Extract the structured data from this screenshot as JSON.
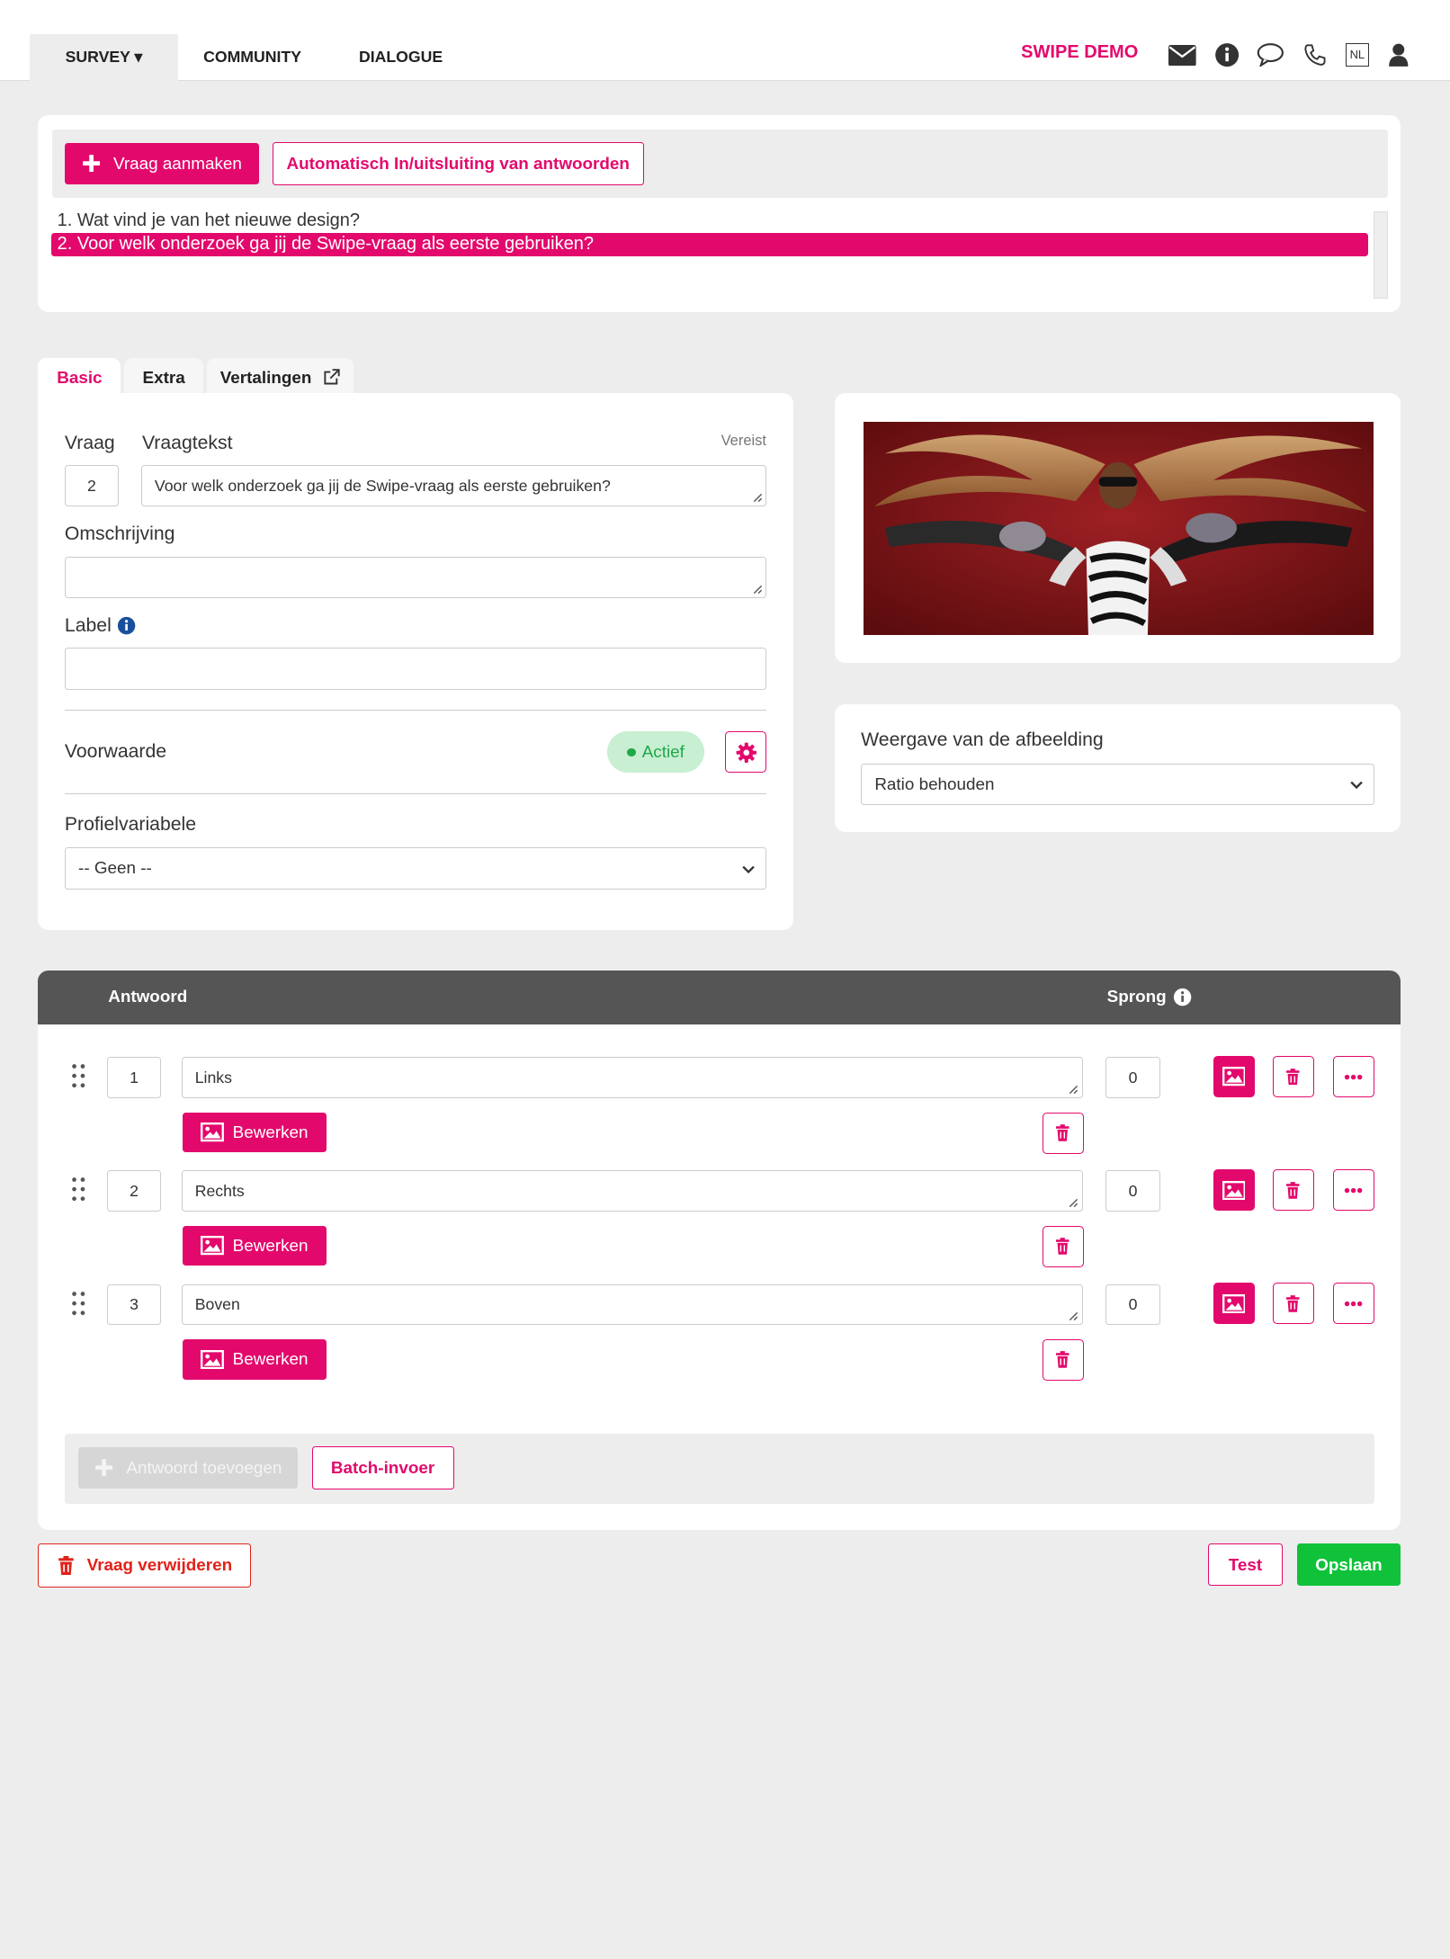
{
  "nav": {
    "tabs": [
      {
        "label": "SURVEY ▾"
      },
      {
        "label": "COMMUNITY"
      },
      {
        "label": "DIALOGUE"
      }
    ],
    "brand": "SWIPE DEMO",
    "lang": "NL",
    "icons": [
      "envelope-icon",
      "info-icon",
      "chat-icon",
      "phone-icon",
      "language-icon",
      "user-icon"
    ]
  },
  "toolbar": {
    "create_label": "Vraag aanmaken",
    "auto_label": "Automatisch In/uitsluiting van antwoorden"
  },
  "questions": [
    {
      "text": "1. Wat vind je van het nieuwe design?",
      "selected": false
    },
    {
      "text": "2. Voor welk onderzoek ga jij de Swipe-vraag als eerste gebruiken?",
      "selected": true
    }
  ],
  "tabs": [
    {
      "label": "Basic",
      "active": true
    },
    {
      "label": "Extra",
      "active": false
    },
    {
      "label": "Vertalingen",
      "active": false
    }
  ],
  "form": {
    "vraag_label": "Vraag",
    "vraagtekst_label": "Vraagtekst",
    "required_label": "Vereist",
    "vraag_number": "2",
    "vraagtekst_value": "Voor welk onderzoek ga jij de Swipe-vraag als eerste gebruiken?",
    "omschrijving_label": "Omschrijving",
    "omschrijving_value": "",
    "label_label": "Label",
    "label_value": "",
    "voorwaarde_label": "Voorwaarde",
    "status_label": "Actief",
    "profiel_label": "Profielvariabele",
    "profiel_value": "-- Geen --"
  },
  "image_settings": {
    "label": "Weergave van de afbeelding",
    "value": "Ratio behouden"
  },
  "answers_header": {
    "answer_label": "Antwoord",
    "jump_label": "Sprong"
  },
  "answers": [
    {
      "number": "1",
      "text": "Links",
      "jump": "0",
      "edit_label": "Bewerken"
    },
    {
      "number": "2",
      "text": "Rechts",
      "jump": "0",
      "edit_label": "Bewerken"
    },
    {
      "number": "3",
      "text": "Boven",
      "jump": "0",
      "edit_label": "Bewerken"
    }
  ],
  "answer_actions": {
    "add_label": "Antwoord toevoegen",
    "batch_label": "Batch-invoer"
  },
  "footer": {
    "delete_label": "Vraag verwijderen",
    "test_label": "Test",
    "save_label": "Opslaan"
  },
  "colors": {
    "accent": "#e3096c",
    "save": "#0fc23a",
    "danger": "#e0221a",
    "active_pill_bg": "#c8efd2",
    "active_pill_text": "#1fa84a"
  }
}
